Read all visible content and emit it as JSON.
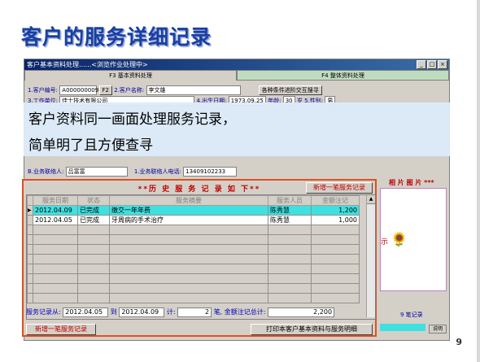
{
  "slide": {
    "title": "客户的服务详细记录",
    "page_number": "9"
  },
  "window": {
    "title": "客户基本资料处理......<浏览作业处理中>",
    "tabs": [
      "F3 基本资料处理",
      "F4 整体资料处理"
    ],
    "customer_no_label": "1.客户编号:",
    "customer_no": "A000000009",
    "customer_no_btn": "F2",
    "customer_name_label": "2.客户名称:",
    "customer_name": "李文雄",
    "search_btn": "各种条件进阶交互搜寻",
    "work_unit_label": "3.工作单位:",
    "work_unit": "佳士技术有限公司",
    "birth_label": "4.出生日期:",
    "birth_value": "1973.09.25",
    "age_label": "年龄:",
    "age_value": "30",
    "age_unit": "岁",
    "gender_label": "5.性别:",
    "gender_value": "男",
    "contact_label": "B.业务联络人:",
    "contact_value": "吕富富",
    "contact_phone_label": "1.业务联络人电话:",
    "contact_phone_value": "13409102233"
  },
  "callout": {
    "line1": "客户资料同一画面处理服务记录，",
    "line2": "简单明了且方便查寻"
  },
  "history": {
    "title": "**历 史 服 务 记 录 如 下**",
    "add_btn_top": "新增一笔服务记录",
    "columns": [
      "服务日期",
      "状态",
      "服务摘要",
      "服务人员",
      "金额注记"
    ],
    "rows": [
      {
        "date": "2012.04.09",
        "status": "已完成",
        "summary": "缴交一年年费",
        "staff": "陈秀慧",
        "amount": "1,200"
      },
      {
        "date": "2012.04.05",
        "status": "已完成",
        "summary": "牙周病的手术治疗",
        "staff": "陈秀慧",
        "amount": "1,000"
      }
    ],
    "summary_from_label": "服务记录从:",
    "summary_from": "2012.04.05",
    "summary_to_label": "到",
    "summary_to": "2012.04.09",
    "summary_count_label": "计:",
    "summary_count": "2",
    "summary_count_unit": "笔,",
    "summary_total_label": "金额注记总计:",
    "summary_total": "2,200",
    "add_btn_bottom": "新增一笔服务记录",
    "print_btn": "打印本客户基本资料与服务明细"
  },
  "side": {
    "picture_label": "相 片 图 片  ***",
    "record_count": "9 笔记录",
    "help_btn": "说明",
    "mascot_text": "示"
  }
}
